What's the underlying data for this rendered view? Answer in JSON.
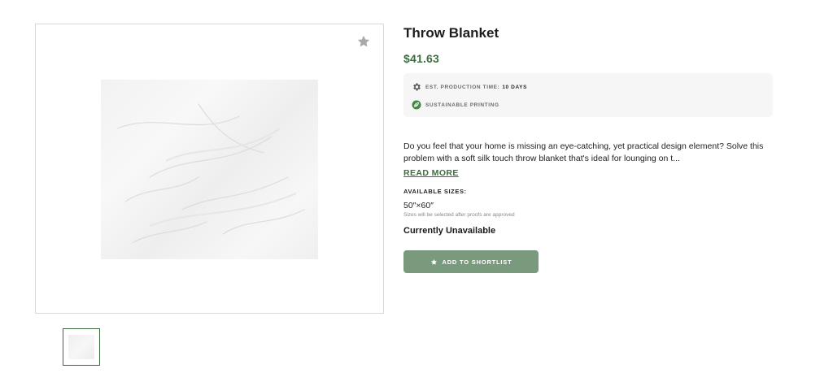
{
  "product": {
    "title": "Throw Blanket",
    "price": "$41.63",
    "meta": {
      "production_label": "EST. PRODUCTION TIME:",
      "production_value": "10 DAYS",
      "sustainable_label": "SUSTAINABLE PRINTING"
    },
    "description": "Do you feel that your home is missing an eye-catching, yet practical design element? Solve this problem with a soft silk touch throw blanket that's ideal for lounging on t...",
    "read_more": "READ MORE",
    "sizes_heading": "AVAILABLE SIZES:",
    "size_value": "50″×60″",
    "size_note": "Sizes will be selected after proofs are approved",
    "availability": "Currently Unavailable",
    "add_button": "ADD TO SHORTLIST"
  },
  "icons": {
    "favorite": "star-icon",
    "production": "gear-icon",
    "sustainable": "leaf-icon",
    "add": "star-icon"
  },
  "colors": {
    "accent_green": "#3c6e3f",
    "button_green": "#7a9a7e",
    "meta_bg": "#f6f6f6"
  }
}
